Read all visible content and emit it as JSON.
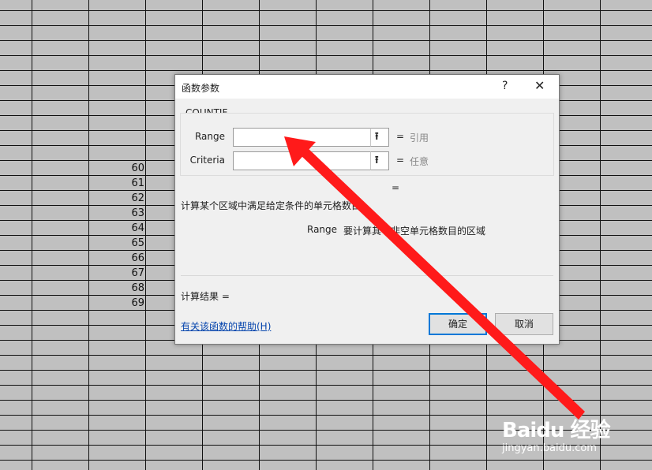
{
  "spreadsheet": {
    "row_numbers": [
      "60",
      "61",
      "62",
      "63",
      "64",
      "65",
      "66",
      "67",
      "68",
      "69"
    ]
  },
  "dialog": {
    "title": "函数参数",
    "help_button": "?",
    "close_button": "✕",
    "function_name": "COUNTIF",
    "args": [
      {
        "label": "Range",
        "value": "",
        "eq": "=",
        "hint": "引用"
      },
      {
        "label": "Criteria",
        "value": "",
        "eq": "=",
        "hint": "任意"
      }
    ],
    "result_eq": "=",
    "description": "计算某个区域中满足给定条件的单元格数目",
    "arg_desc_name": "Range",
    "arg_desc_text": "要计算其中非空单元格数目的区域",
    "calc_result": "计算结果 =",
    "help_link": "有关该函数的帮助(H)",
    "ok": "确定",
    "cancel": "取消"
  },
  "watermark": {
    "brand": "Baidu 经验",
    "url": "jingyan.baidu.com"
  },
  "colors": {
    "arrow": "#ff1a1a",
    "link": "#0645ad",
    "ok_border": "#0078d7",
    "sheet_bg": "#c0c0c0"
  }
}
